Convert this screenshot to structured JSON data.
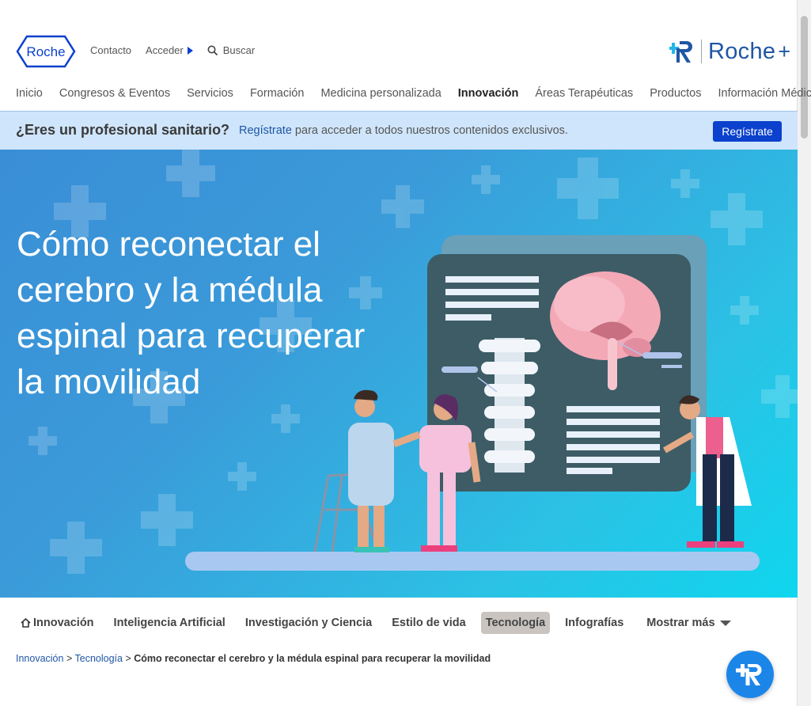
{
  "header": {
    "logo_text": "Roche",
    "links": {
      "contact": "Contacto",
      "login": "Acceder",
      "search": "Buscar"
    },
    "brand_plus": {
      "name": "Roche",
      "suffix": "+"
    }
  },
  "main_nav": {
    "items": [
      "Inicio",
      "Congresos & Eventos",
      "Servicios",
      "Formación",
      "Medicina personalizada",
      "Innovación",
      "Áreas Terapéuticas",
      "Productos",
      "Información Médica"
    ],
    "active": "Innovación"
  },
  "pro_banner": {
    "question": "¿Eres un profesional sanitario?",
    "link_text": "Regístrate",
    "message": " para acceder a todos nuestros contenidos exclusivos.",
    "button_label": "Regístrate"
  },
  "hero": {
    "title": "Cómo reconectar el cerebro y la médula espinal para recuperar la movilidad"
  },
  "sub_nav": {
    "items": [
      "Innovación",
      "Inteligencia Artificial",
      "Investigación y Ciencia",
      "Estilo de vida",
      "Tecnología",
      "Infografías"
    ],
    "active": "Tecnología",
    "more_label": "Mostrar más"
  },
  "breadcrumb": {
    "items": [
      "Innovación",
      "Tecnología"
    ],
    "separator": " > ",
    "current": "Cómo reconectar el cerebro y la médula espinal para recuperar la movilidad"
  },
  "colors": {
    "brand_blue": "#0b41cd",
    "link_blue": "#1f56a5",
    "banner_bg": "#cfe5fb",
    "fab_blue": "#1c86e8",
    "active_tab_bg": "#c9c4c0"
  },
  "icons": {
    "logo": "roche-hexagon-logo",
    "search": "search-icon",
    "home": "home-icon",
    "fab": "roche-plus-chat-icon"
  }
}
